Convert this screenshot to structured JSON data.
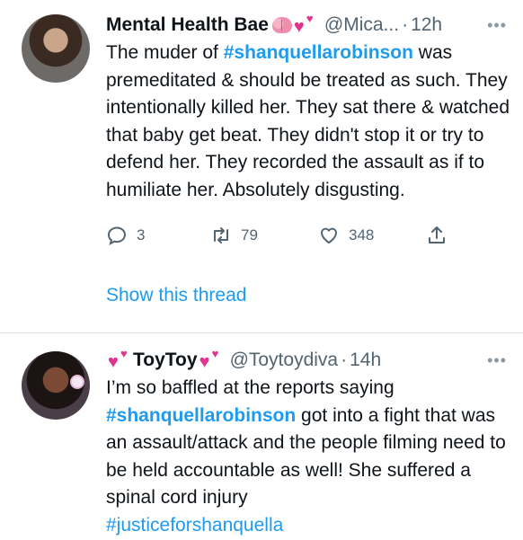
{
  "tweets": [
    {
      "display_name": "Mental Health Bae",
      "handle": "@Mica...",
      "separator": "·",
      "time": "12h",
      "more_icon": "ellipsis-icon",
      "name_emojis": [
        "brain-icon",
        "sparkling-heart-icon"
      ],
      "text_parts": [
        {
          "text": "The muder of ",
          "type": "text"
        },
        {
          "text": "#shanquellarobinson",
          "type": "hashtag"
        },
        {
          "text": " was premeditated & should be treated as such. They intentionally killed her. They sat there & watched that baby get beat. They didn't stop it or try to defend her. They recorded the assault as if to humiliate her. Absolutely disgusting.",
          "type": "text"
        }
      ],
      "actions": {
        "reply_count": "3",
        "retweet_count": "79",
        "like_count": "348"
      },
      "show_thread_label": "Show this thread"
    },
    {
      "display_name": "ToyToy",
      "handle": "@Toytoydiva",
      "separator": "·",
      "time": "14h",
      "more_icon": "ellipsis-icon",
      "name_emojis": [
        "sparkling-heart-icon",
        "sparkling-heart-icon"
      ],
      "text_lines": [
        {
          "text": "I’m so baffled at the reports saying",
          "type": "text"
        },
        {
          "text": "#shanquellarobinson",
          "type": "hashtag"
        },
        {
          "text": " got into a fight that was an assault/attack and the people filming need to be held accountable as well! She suffered a spinal cord injury",
          "type": "text"
        },
        {
          "text": "#justiceforshanquella",
          "type": "hashtag-plain"
        }
      ]
    }
  ],
  "colors": {
    "link": "#1d9bf0",
    "text": "#0f1419",
    "secondary": "#536471",
    "heart": "#e0358e"
  }
}
